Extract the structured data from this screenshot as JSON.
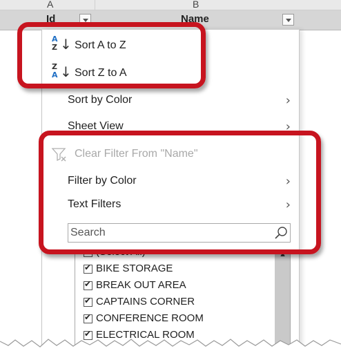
{
  "sheet": {
    "columns": [
      {
        "letter": "A",
        "header": "Id"
      },
      {
        "letter": "B",
        "header": "Name"
      }
    ]
  },
  "menu": {
    "sort_az": {
      "label": "Sort A to Z",
      "icon": "sort-ascending-icon"
    },
    "sort_za": {
      "label": "Sort Z to A",
      "icon": "sort-descending-icon"
    },
    "sort_by_color": {
      "label": "Sort by Color"
    },
    "sheet_view": {
      "label": "Sheet View"
    },
    "clear_filter": {
      "label": "Clear Filter From \"Name\"",
      "disabled": true,
      "icon": "clear-filter-icon"
    },
    "filter_by_color": {
      "label": "Filter by Color"
    },
    "text_filters": {
      "label": "Text Filters"
    },
    "search": {
      "placeholder": "Search"
    },
    "items": [
      {
        "label": "(Select All)",
        "checked": true
      },
      {
        "label": "BIKE STORAGE",
        "checked": true
      },
      {
        "label": "BREAK OUT AREA",
        "checked": true
      },
      {
        "label": "CAPTAINS CORNER",
        "checked": true
      },
      {
        "label": "CONFERENCE ROOM",
        "checked": true
      },
      {
        "label": "ELECTRICAL ROOM",
        "checked": true
      }
    ]
  },
  "colors": {
    "highlight": "#c7141f",
    "sort_letter_blue": "#1f6fc5",
    "header_bg": "#d6d6d6"
  }
}
